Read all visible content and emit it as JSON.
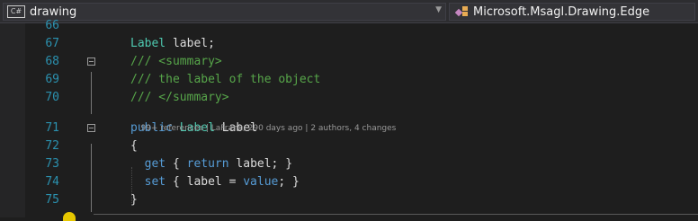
{
  "navbar": {
    "project_label": "drawing",
    "project_icon": "csharp-file-icon",
    "member_label": "Microsoft.Msagl.Drawing.Edge",
    "member_icon": "class-member-icon"
  },
  "codelens": {
    "references": "99+ references",
    "sep1": " | ",
    "author": "LaFrank, 290 days ago",
    "sep2": " | ",
    "changes": "2 authors, 4 changes"
  },
  "lines": [
    {
      "num": "66",
      "t": []
    },
    {
      "num": "67",
      "t": [
        [
          "type",
          "Label"
        ],
        [
          "id",
          " label;"
        ]
      ]
    },
    {
      "num": "68",
      "t": [
        [
          "cm",
          "/// <summary>"
        ]
      ]
    },
    {
      "num": "69",
      "t": [
        [
          "cm",
          "/// the label of the object"
        ]
      ]
    },
    {
      "num": "70",
      "t": [
        [
          "cm",
          "/// </summary>"
        ]
      ]
    },
    {
      "num": "71",
      "t": [
        [
          "kw",
          "public"
        ],
        [
          "id",
          " "
        ],
        [
          "type",
          "Label"
        ],
        [
          "id",
          " Label"
        ]
      ]
    },
    {
      "num": "72",
      "t": [
        [
          "id",
          "{"
        ]
      ]
    },
    {
      "num": "73",
      "t": [
        [
          "id",
          "  "
        ],
        [
          "kw",
          "get"
        ],
        [
          "id",
          " { "
        ],
        [
          "kw",
          "return"
        ],
        [
          "id",
          " label; }"
        ]
      ]
    },
    {
      "num": "74",
      "t": [
        [
          "id",
          "  "
        ],
        [
          "kw",
          "set"
        ],
        [
          "id",
          " { label = "
        ],
        [
          "kw",
          "value"
        ],
        [
          "id",
          "; }"
        ]
      ]
    },
    {
      "num": "75",
      "t": [
        [
          "id",
          "}"
        ]
      ]
    }
  ],
  "colors": {
    "background": "#1e1e1e",
    "line_number": "#2b91af",
    "keyword": "#569cd6",
    "type": "#4ec9b0",
    "comment": "#57a64a",
    "identifier": "#dcdcdc"
  }
}
